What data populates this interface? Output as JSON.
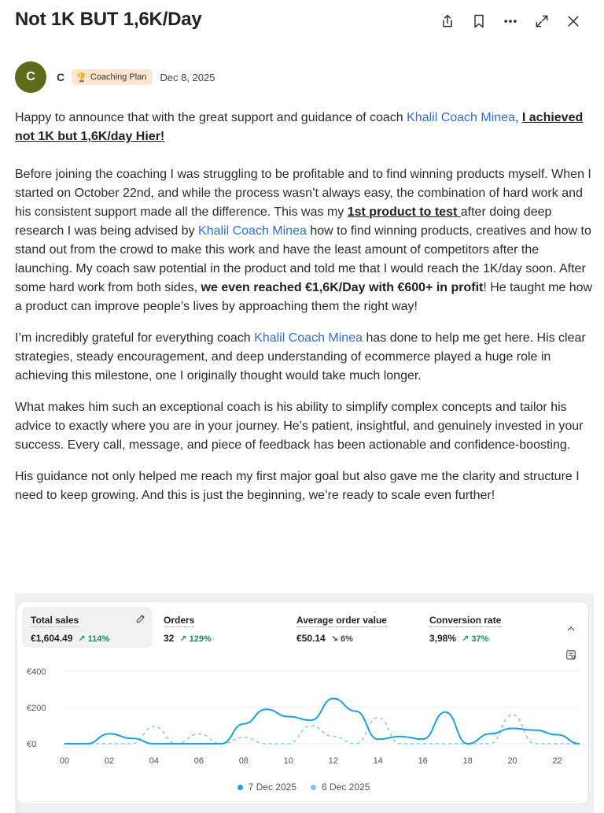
{
  "post": {
    "title": "Not 1K BUT 1,6K/Day",
    "author_initial": "C",
    "author_name": "C",
    "badge": "Coaching Plan",
    "date": "Dec 8, 2025"
  },
  "header_icons": [
    "share-icon",
    "bookmark-icon",
    "more-icon",
    "expand-icon",
    "close-icon"
  ],
  "body": {
    "p1_a": "Happy to announce that with the great support and guidance of coach ",
    "p1_link": "Khalil Coach Minea",
    "p1_b": ", ",
    "p1_bold": "I achieved not 1K but 1,6K/day Hier!",
    "p2_a": "Before joining the coaching I was struggling to be profitable and to find winning products myself. When I started on October 22nd, and while the process wasn’t always easy, the combination of hard work and his consistent support made all the difference. This was my ",
    "p2_bold": "1st product to test ",
    "p2_b": "after doing deep research I was being advised by ",
    "p2_link": "Khalil Coach Minea",
    "p2_c": " how to find winning products, creatives and how to stand out from the crowd to make this work and have the least amount of competitors after the launching. My coach saw potential in the product and told me that I would reach the 1K/day soon. After some hard work from both sides, ",
    "p2_strong": "we even reached €1,6K/Day with €600+ in profit",
    "p2_d": "! He taught me how a product can improve people’s lives by approaching them the right way!",
    "p3_a": "I’m incredibly grateful for everything coach ",
    "p3_link": "Khalil Coach Minea",
    "p3_b": " has done to help me get here. His clear strategies, steady encouragement, and deep understanding of ecommerce played a huge role in achieving this milestone, one I originally thought would take much longer.",
    "p4": "What makes him such an exceptional coach is his ability to simplify complex concepts and tailor his advice to exactly where you are in your journey. He’s patient, insightful, and genuinely invested in your success. Every call, message, and piece of feedback has been actionable and confidence-boosting.",
    "p5": "His guidance not only helped me reach my first major goal but also gave me the clarity and structure I need to keep growing. And this is just the beginning, we’re ready to scale even further!"
  },
  "metrics": [
    {
      "label": "Total sales",
      "value": "€1,604.49",
      "change": "114%",
      "direction": "up"
    },
    {
      "label": "Orders",
      "value": "32",
      "change": "129%",
      "direction": "up"
    },
    {
      "label": "Average order value",
      "value": "€50.14",
      "change": "6%",
      "direction": "down"
    },
    {
      "label": "Conversion rate",
      "value": "3,98%",
      "change": "37%",
      "direction": "up"
    }
  ],
  "colors": {
    "current": "#1ba1e2",
    "previous": "#7cc7ee",
    "up": "#1a8f55",
    "link": "#2f6fd3"
  },
  "chart_data": {
    "type": "line",
    "x_ticks": [
      "00",
      "02",
      "04",
      "06",
      "08",
      "10",
      "12",
      "14",
      "16",
      "18",
      "20",
      "22"
    ],
    "y_ticks": [
      "€400",
      "€200",
      "€0"
    ],
    "ylim": [
      0,
      400
    ],
    "x": [
      0,
      1,
      2,
      3,
      4,
      5,
      6,
      7,
      8,
      9,
      10,
      11,
      12,
      13,
      14,
      15,
      16,
      17,
      18,
      19,
      20,
      21,
      22,
      23
    ],
    "series": [
      {
        "name": "7 Dec 2025",
        "style": "solid",
        "values": [
          0,
          0,
          55,
          30,
          0,
          0,
          0,
          0,
          110,
          190,
          150,
          130,
          250,
          180,
          25,
          40,
          25,
          175,
          0,
          55,
          85,
          75,
          50,
          0
        ]
      },
      {
        "name": "6 Dec 2025",
        "style": "dashed",
        "values": [
          0,
          0,
          0,
          0,
          95,
          0,
          55,
          0,
          35,
          0,
          0,
          100,
          40,
          0,
          145,
          0,
          0,
          0,
          0,
          0,
          160,
          0,
          0,
          0
        ]
      }
    ]
  }
}
